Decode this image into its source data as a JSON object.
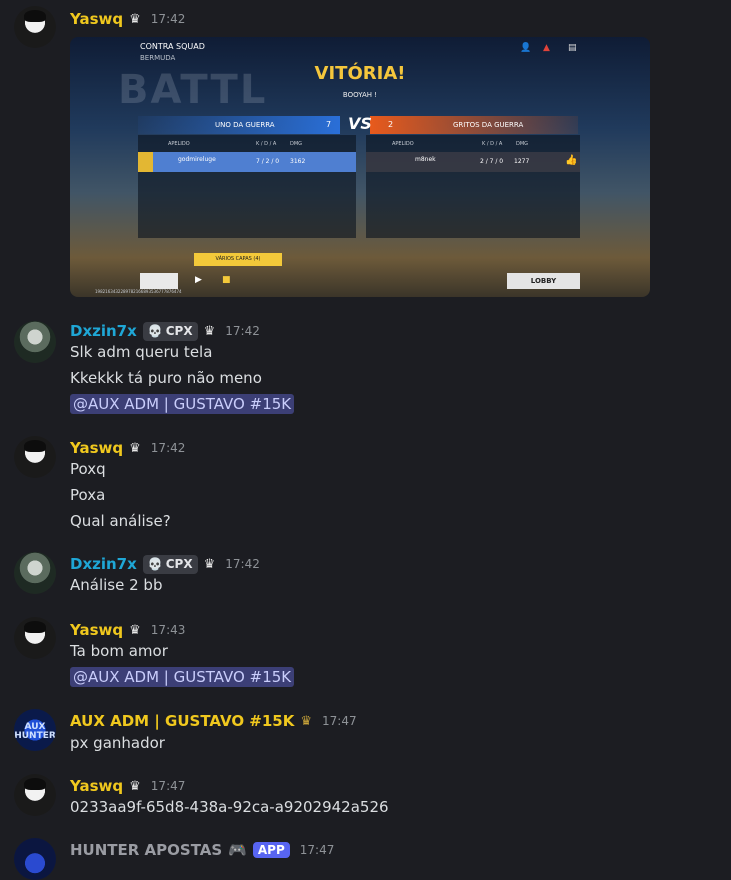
{
  "embed": {
    "mode": "CONTRA SQUAD",
    "map": "BERMUDA",
    "bg_word": "BATTL",
    "result": "VITÓRIA!",
    "subtitle": "BOOYAH !",
    "team_left": "UNO DA GUERRA",
    "score_left": "7",
    "vs": "VS",
    "score_right": "2",
    "team_right": "GRITOS DA GUERRA",
    "col_headers": [
      "APELIDO",
      "K / D / A",
      "DMG"
    ],
    "left_player": {
      "name": "godmireluge",
      "kda": "7 / 2 / 0",
      "dmg": "3162"
    },
    "right_player": {
      "name": "m8nek",
      "kda": "2 / 7 / 0",
      "dmg": "1277"
    },
    "capas_label": "VÁRIOS CAPAS (4)",
    "lobby_label": "LOBBY",
    "match_id": "1982163432289782166893536777876474"
  },
  "messages": [
    {
      "author": "Yaswq",
      "time": "17:42"
    },
    {
      "author": "Dxzin7x",
      "tag": "CPX",
      "time": "17:42",
      "lines": [
        "Slk adm queru tela",
        "Kkekkk tá puro não meno"
      ],
      "mention": "@AUX ADM | GUSTAVO #15K"
    },
    {
      "author": "Yaswq",
      "time": "17:42",
      "lines": [
        "Poxq",
        "Poxa",
        "Qual análise?"
      ]
    },
    {
      "author": "Dxzin7x",
      "tag": "CPX",
      "time": "17:42",
      "lines": [
        "Análise 2 bb"
      ]
    },
    {
      "author": "Yaswq",
      "time": "17:43",
      "lines": [
        "Ta bom amor"
      ],
      "mention": "@AUX ADM | GUSTAVO #15K"
    },
    {
      "author": "AUX ADM | GUSTAVO #15K",
      "avatar_text": "AUX HUNTER",
      "time": "17:47",
      "lines": [
        "px ganhador"
      ]
    },
    {
      "author": "Yaswq",
      "time": "17:47",
      "lines": [
        "0233aa9f-65d8-438a-92ca-a9202942a526"
      ]
    },
    {
      "author": "HUNTER APOSTAS",
      "tag": "APP",
      "time": "17:47"
    }
  ]
}
